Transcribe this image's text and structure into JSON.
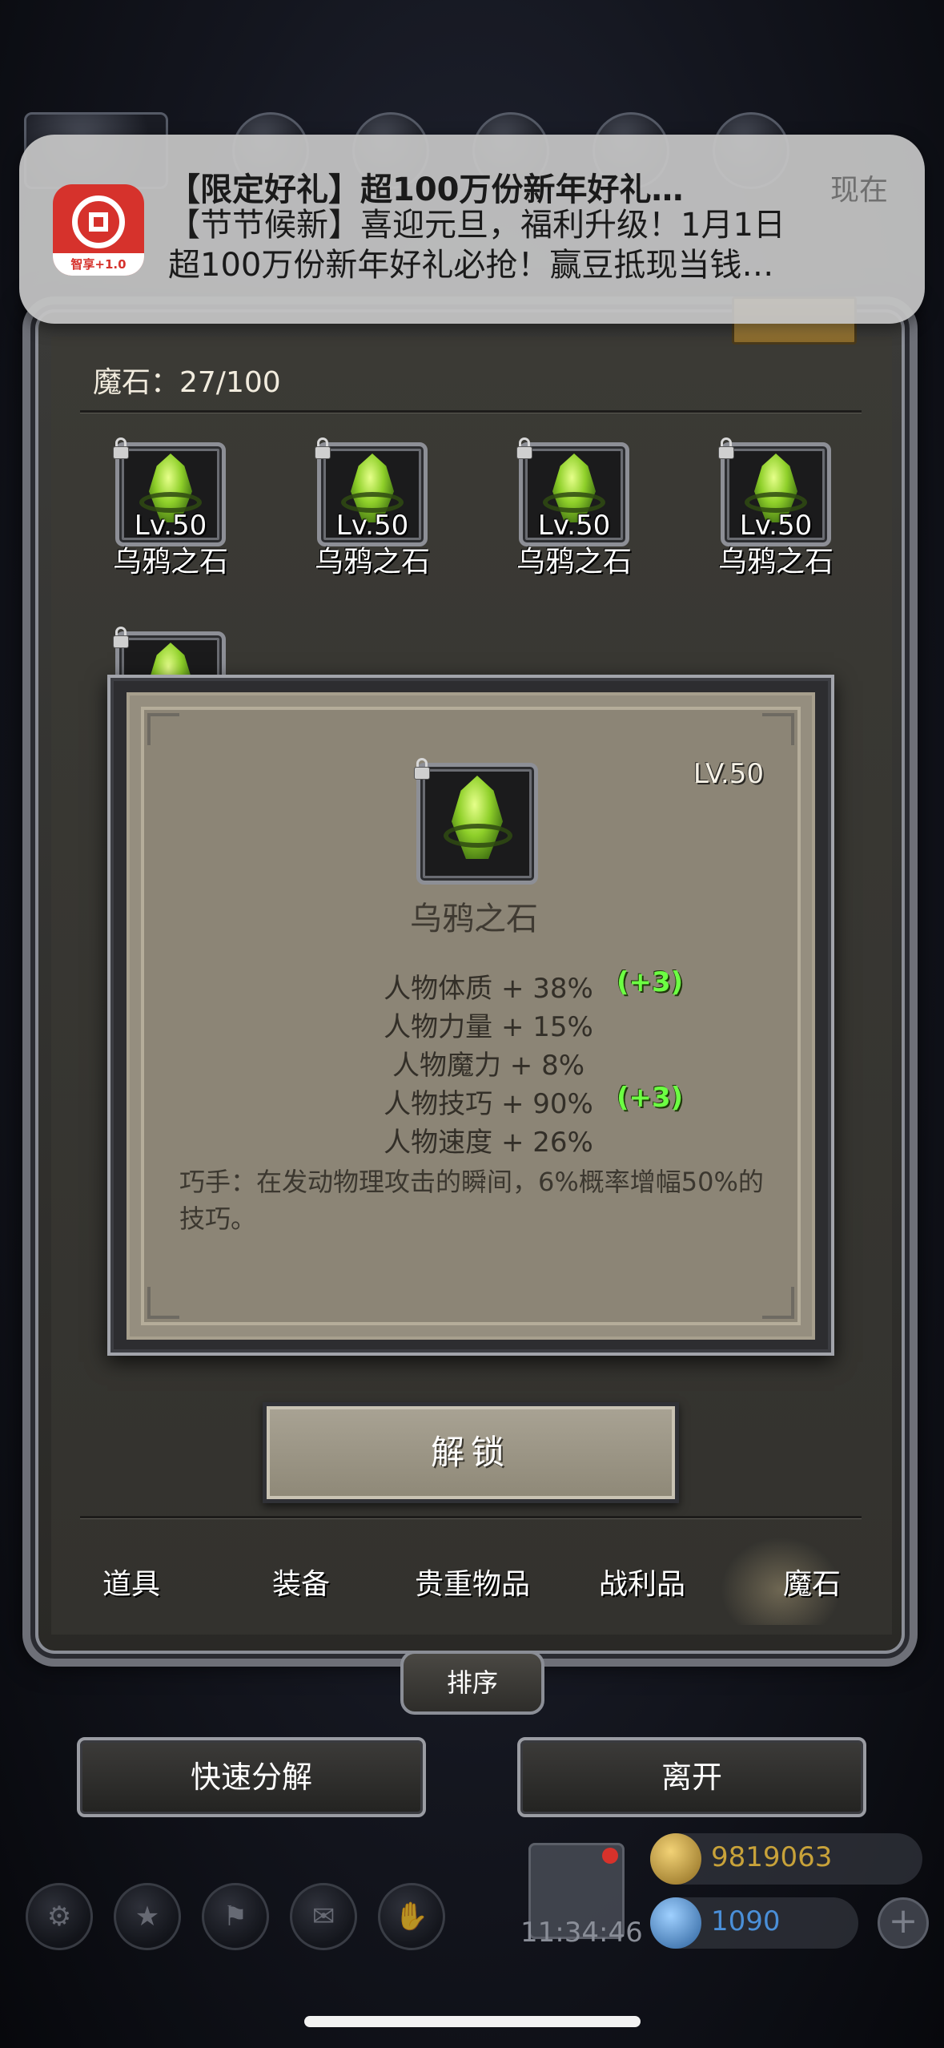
{
  "notification": {
    "app_icon": "bank-app-icon",
    "app_icon_tag": "智享+1.0",
    "title": "【限定好礼】超100万份新年好礼…",
    "time": "现在",
    "body_line1": "【节节候新】喜迎元旦，福利升级！1月1日",
    "body_line2": "超100万份新年好礼必抢！赢豆抵现当钱…"
  },
  "inventory": {
    "count_label": "魔石：27/100",
    "items": [
      {
        "level": "Lv.50",
        "name": "乌鸦之石"
      },
      {
        "level": "Lv.50",
        "name": "乌鸦之石"
      },
      {
        "level": "Lv.50",
        "name": "乌鸦之石"
      },
      {
        "level": "Lv.50",
        "name": "乌鸦之石"
      },
      {
        "level": "",
        "name": ""
      }
    ]
  },
  "detail": {
    "level": "LV.50",
    "name": "乌鸦之石",
    "stats": [
      {
        "text": "人物体质 + 38%",
        "bonus": "(+3)"
      },
      {
        "text": "人物力量 + 15%",
        "bonus": ""
      },
      {
        "text": "人物魔力 + 8%",
        "bonus": ""
      },
      {
        "text": "人物技巧 + 90%",
        "bonus": "(+3)"
      },
      {
        "text": "人物速度 + 26%",
        "bonus": ""
      }
    ],
    "description": "巧手：在发动物理攻击的瞬间，6%概率增幅50%的技巧。",
    "unlock_label": "解锁"
  },
  "tabs": [
    {
      "label": "道具",
      "active": false
    },
    {
      "label": "装备",
      "active": false
    },
    {
      "label": "贵重物品",
      "active": false
    },
    {
      "label": "战利品",
      "active": false
    },
    {
      "label": "魔石",
      "active": true
    }
  ],
  "actions": {
    "sort_label": "排序",
    "quick_decompose_label": "快速分解",
    "leave_label": "离开"
  },
  "footer": {
    "clock": "11:34:46",
    "gold": "9819063",
    "gems": "1090",
    "gold_color": "#c8a23a",
    "gem_color": "#4a8fd8"
  }
}
